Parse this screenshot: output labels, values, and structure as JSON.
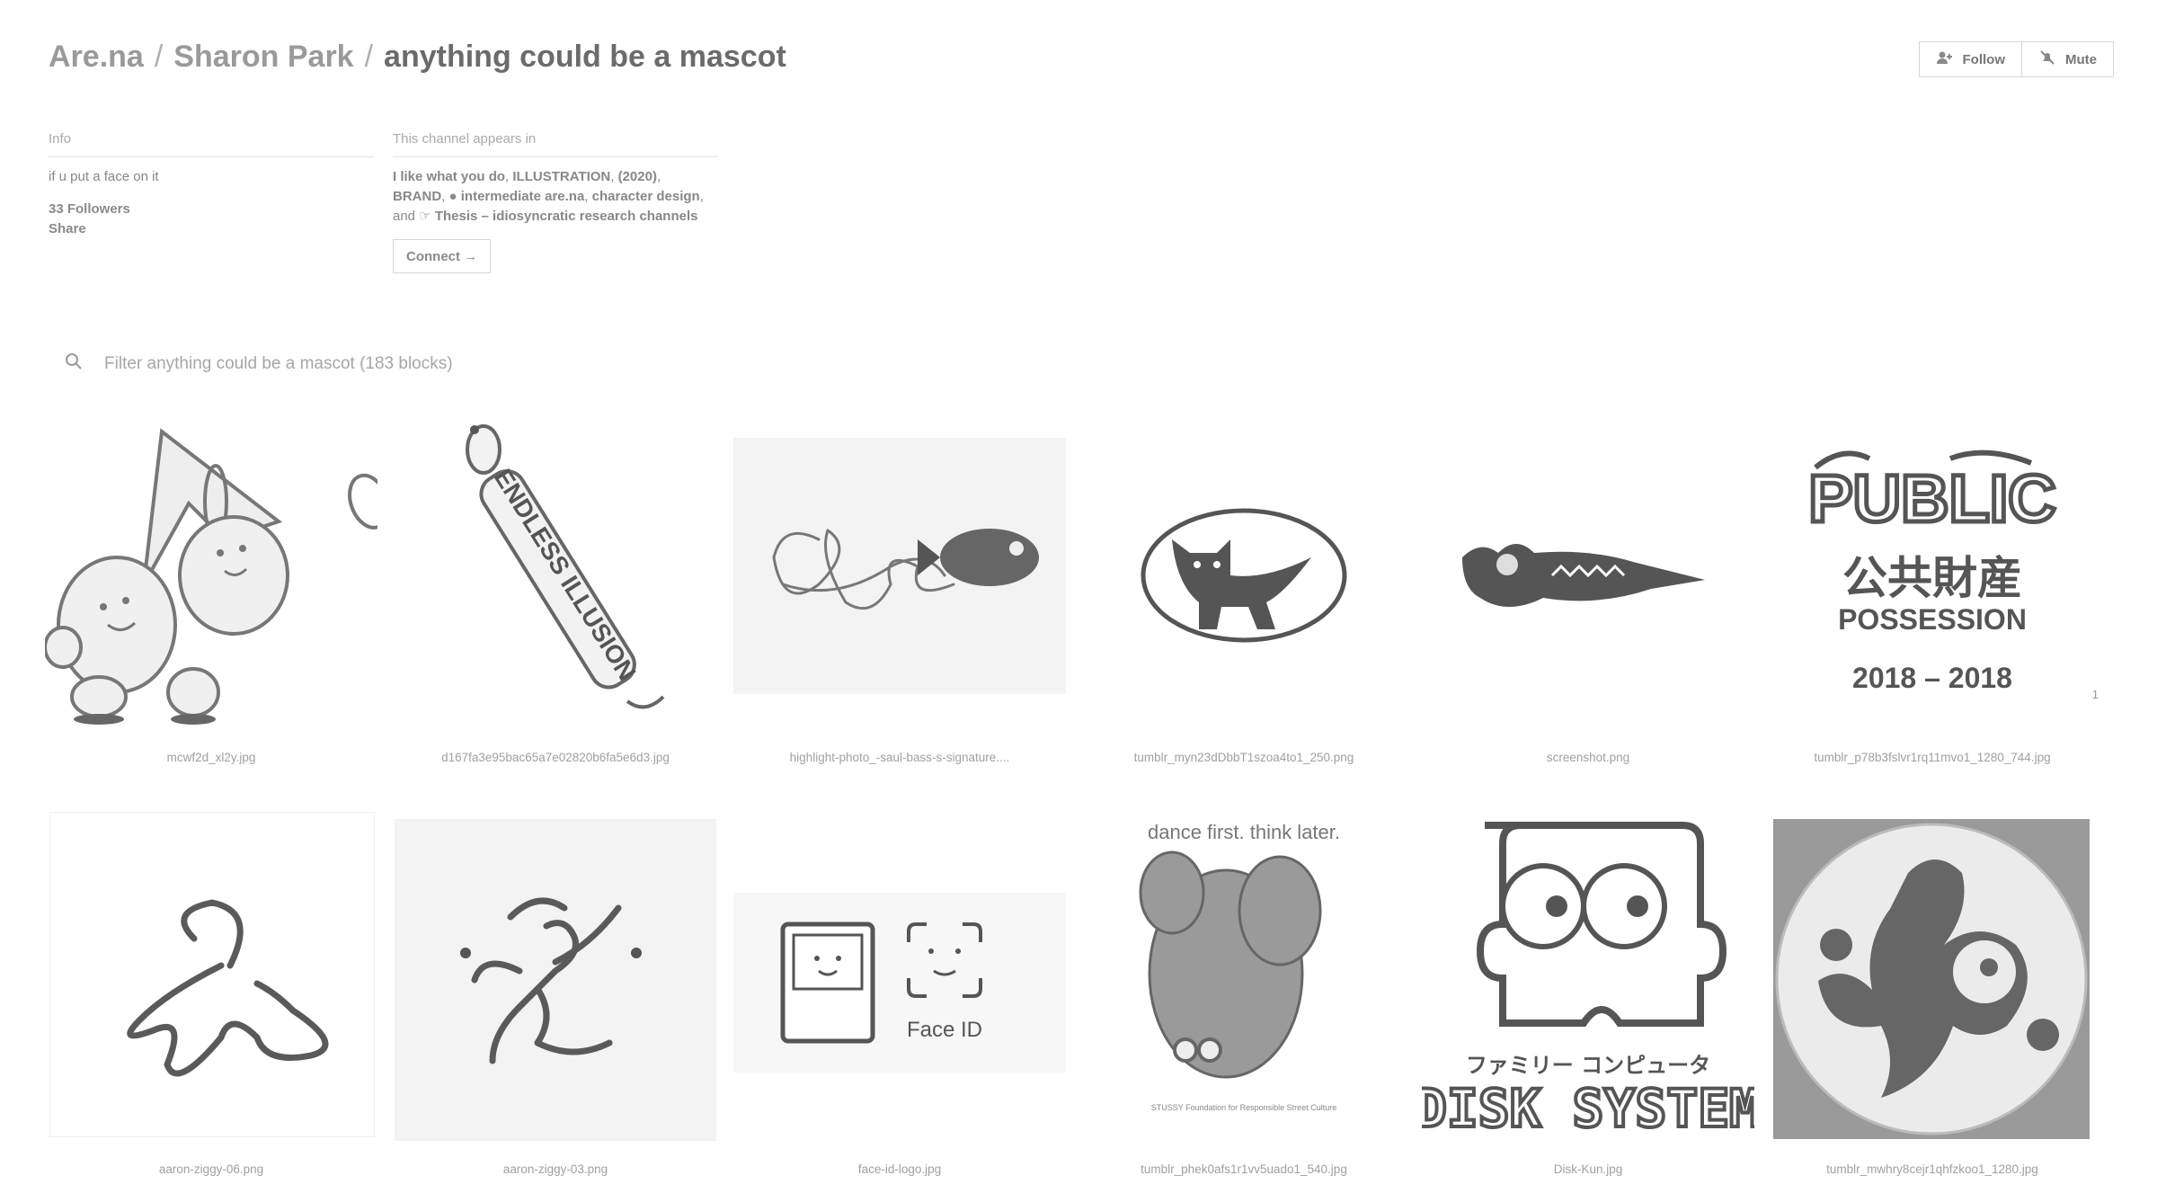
{
  "breadcrumb": {
    "site": "Are.na",
    "user": "Sharon Park",
    "channel": "anything could be a mascot",
    "separator": "/"
  },
  "actions": {
    "follow": "Follow",
    "mute": "Mute"
  },
  "info": {
    "heading": "Info",
    "description": "if u put a face on it",
    "followers": "33 Followers",
    "share": "Share"
  },
  "appears_in": {
    "heading": "This channel appears in",
    "channels": [
      "I like what you do",
      "ILLUSTRATION",
      "(2020)",
      "BRAND",
      "intermediate are.na",
      "character design",
      "Thesis – idiosyncratic research channels"
    ],
    "sep": ", ",
    "and": "and",
    "connect_button": "Connect →"
  },
  "filter": {
    "placeholder": "Filter anything could be a mascot (183 blocks)"
  },
  "blocks": [
    {
      "caption": "mcwf2d_xl2y.jpg",
      "icon": "walking-blob-character"
    },
    {
      "caption": "d167fa3e95bac65a7e02820b6fa5e6d3.jpg",
      "icon": "endless-illusion-dachshund",
      "text": "ENDLESS ILLUSION"
    },
    {
      "caption": "highlight-photo_-saul-bass-s-signature....",
      "icon": "signature-and-fish"
    },
    {
      "caption": "tumblr_myn23dDbbT1szoa4to1_250.png",
      "icon": "black-cat-oval"
    },
    {
      "caption": "screenshot.png",
      "icon": "crocodile"
    },
    {
      "caption": "tumblr_p78b3fslvr1rq11mvo1_1280_744.jpg",
      "icon": "public-possession",
      "lines": [
        "PUBLIC",
        "公共財産",
        "POSSESSION",
        "2018 – 2018"
      ],
      "badge": "1"
    },
    {
      "caption": "aaron-ziggy-06.png",
      "icon": "ziggy-figure-crouch"
    },
    {
      "caption": "aaron-ziggy-03.png",
      "icon": "ziggy-figure-dance"
    },
    {
      "caption": "face-id-logo.jpg",
      "icon": "face-id",
      "text": "Face ID"
    },
    {
      "caption": "tumblr_phek0afs1r1vv5uado1_540.jpg",
      "icon": "elephant",
      "text": "dance first. think later.",
      "footer": "STUSSY Foundation for Responsible Street Culture"
    },
    {
      "caption": "Disk-Kun.jpg",
      "icon": "disk-kun",
      "lines": [
        "ファミリー コンピュータ",
        "DISK SYSTEM"
      ]
    },
    {
      "caption": "tumblr_mwhry8cejr1qhfzkoo1_1280.jpg",
      "icon": "gecko-badge"
    }
  ]
}
